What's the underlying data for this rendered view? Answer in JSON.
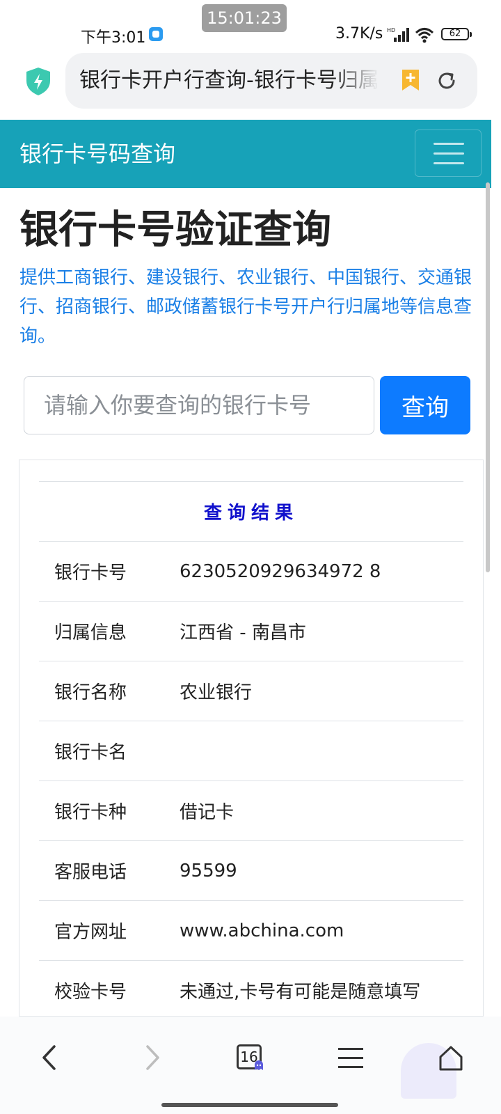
{
  "status_bar": {
    "pill_time": "15:01:23",
    "time": "下午3:01",
    "net_speed": "3.7K/s",
    "battery": "62"
  },
  "browser": {
    "url_text": "银行卡开户行查询-银行卡号归属地查询",
    "tab_count": "16"
  },
  "navbar": {
    "brand": "银行卡号码查询"
  },
  "main": {
    "title": "银行卡号验证查询",
    "description": "提供工商银行、建设银行、农业银行、中国银行、交通银行、招商银行、邮政储蓄银行卡号开户行归属地等信息查询。",
    "search": {
      "placeholder": "请输入你要查询的银行卡号",
      "value": "",
      "button_label": "查询"
    }
  },
  "result": {
    "caption": "查询结果",
    "rows": [
      {
        "label": "银行卡号",
        "value": "6230520929634972 8"
      },
      {
        "label": "归属信息",
        "value": "江西省 - 南昌市"
      },
      {
        "label": "银行名称",
        "value": "农业银行"
      },
      {
        "label": "银行卡名",
        "value": ""
      },
      {
        "label": "银行卡种",
        "value": "借记卡"
      },
      {
        "label": "客服电话",
        "value": "95599"
      },
      {
        "label": "官方网址",
        "value": "www.abchina.com"
      },
      {
        "label": "校验卡号",
        "value": "未通过,卡号有可能是随意填写"
      }
    ]
  },
  "colors": {
    "navbar_bg": "#17a2b8",
    "link_blue": "#1a7fe6",
    "button_blue": "#0d7bff",
    "caption_blue": "#1111cc"
  }
}
